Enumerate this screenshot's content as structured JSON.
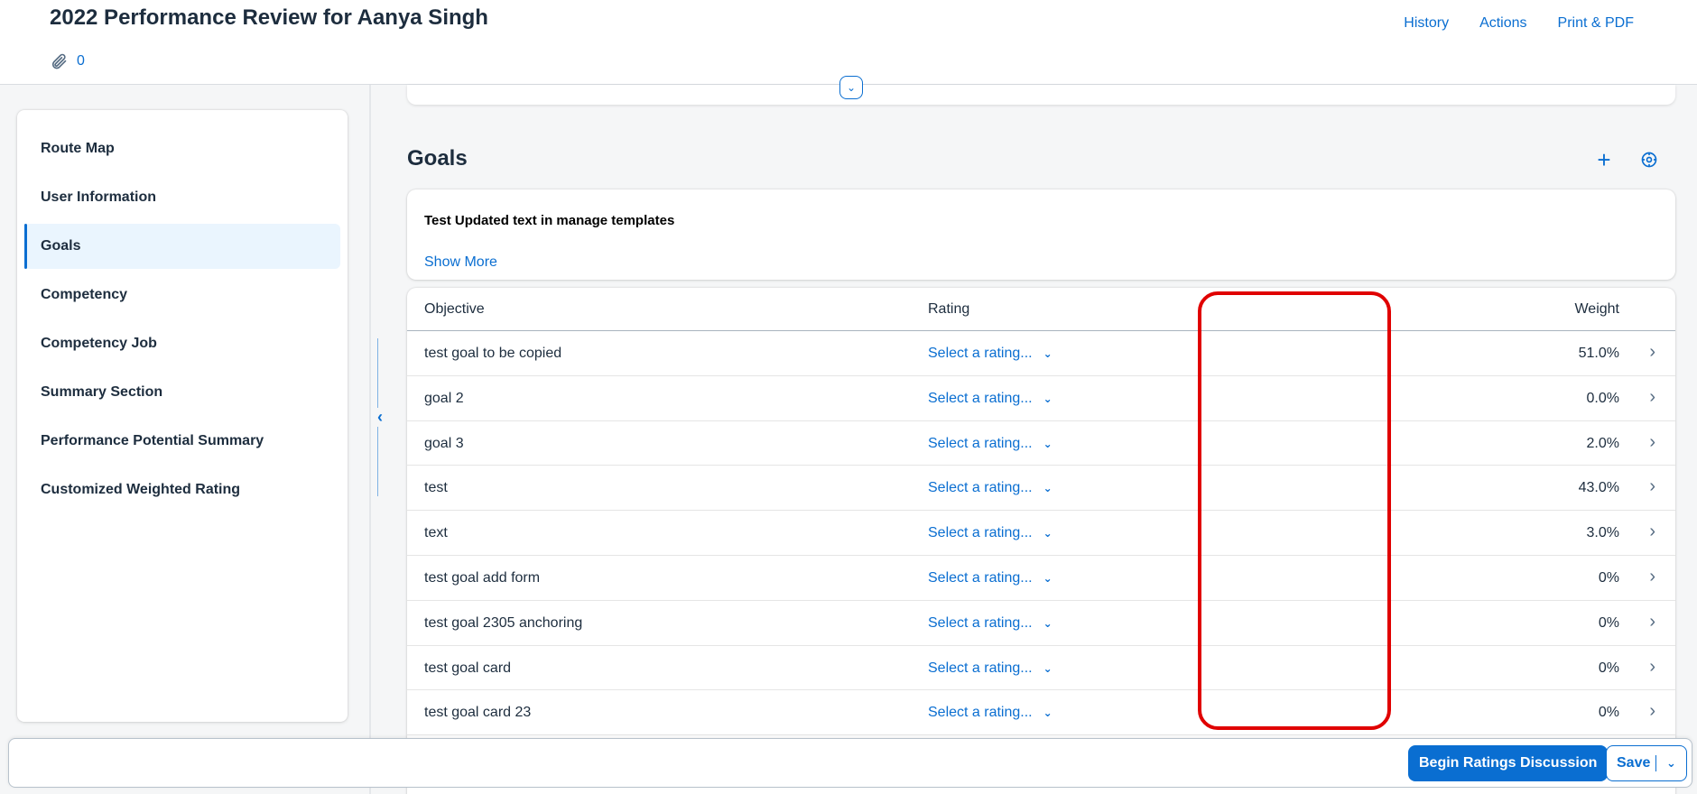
{
  "header": {
    "title": "2022 Performance Review for Aanya Singh",
    "attachment_count": "0",
    "actions": [
      "History",
      "Actions",
      "Print & PDF"
    ]
  },
  "sidebar": {
    "items": [
      {
        "label": "Route Map"
      },
      {
        "label": "User Information"
      },
      {
        "label": "Goals"
      },
      {
        "label": "Competency"
      },
      {
        "label": "Competency Job"
      },
      {
        "label": "Summary Section"
      },
      {
        "label": "Performance Potential Summary"
      },
      {
        "label": "Customized Weighted Rating"
      }
    ],
    "selected": "Goals"
  },
  "main": {
    "section_title": "Goals",
    "intro_text": "Test Updated text in manage templates",
    "show_more_label": "Show More",
    "table": {
      "headers": {
        "objective": "Objective",
        "rating": "Rating",
        "weight": "Weight"
      },
      "rows": [
        {
          "objective": "test goal to be copied",
          "rating": "Select a rating...",
          "weight": "51.0%"
        },
        {
          "objective": "goal 2",
          "rating": "Select a rating...",
          "weight": "0.0%"
        },
        {
          "objective": "goal 3",
          "rating": "Select a rating...",
          "weight": "2.0%"
        },
        {
          "objective": "test",
          "rating": "Select a rating...",
          "weight": "43.0%"
        },
        {
          "objective": "text",
          "rating": "Select a rating...",
          "weight": "3.0%"
        },
        {
          "objective": "test goal add form",
          "rating": "Select a rating...",
          "weight": "0%"
        },
        {
          "objective": "test goal 2305 anchoring",
          "rating": "Select a rating...",
          "weight": "0%"
        },
        {
          "objective": "test goal card",
          "rating": "Select a rating...",
          "weight": "0%"
        },
        {
          "objective": "test goal card 23",
          "rating": "Select a rating...",
          "weight": "0%"
        }
      ]
    }
  },
  "footer": {
    "primary_label": "Begin Ratings Discussion",
    "save_label": "Save"
  },
  "colors": {
    "accent": "#0a6ed1",
    "highlight": "#e00000"
  }
}
